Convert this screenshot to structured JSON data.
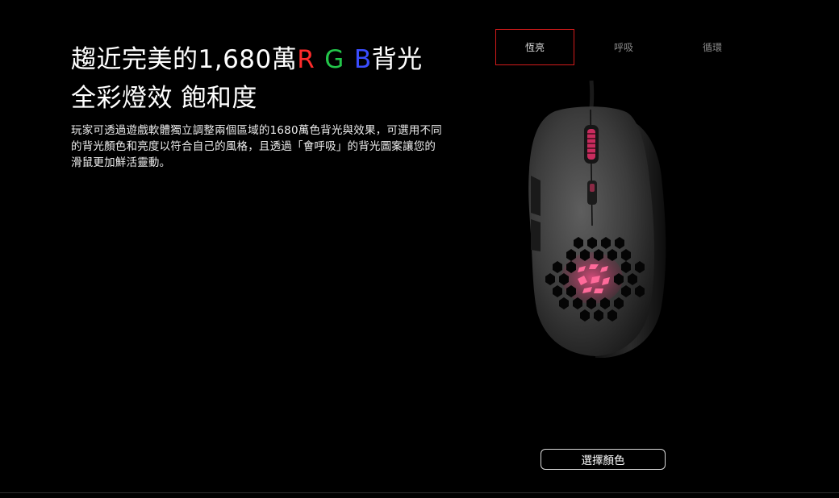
{
  "headline": {
    "line1_prefix": "趨近完美的1,680萬",
    "rgb_r": "R",
    "rgb_g": "G",
    "rgb_b": "B",
    "line1_suffix": "背光",
    "line2": "全彩燈效 飽和度"
  },
  "description": "玩家可透過遊戲軟體獨立調整兩個區域的1680萬色背光與效果，可選用不同的背光顏色和亮度以符合自己的風格，且透過「會呼吸」的背光圖案讓您的滑鼠更加鮮活靈動。",
  "tabs": [
    {
      "label": "恆亮",
      "active": true
    },
    {
      "label": "呼吸",
      "active": false
    },
    {
      "label": "循環",
      "active": false
    }
  ],
  "buttons": {
    "select_color": "選擇顏色"
  },
  "colors": {
    "background": "#000000",
    "active_tab_border": "#d21b1b",
    "rgb_red": "#ff2b2b",
    "rgb_green": "#23c64a",
    "rgb_blue": "#3a4dff",
    "backlight": "#e0306a"
  }
}
